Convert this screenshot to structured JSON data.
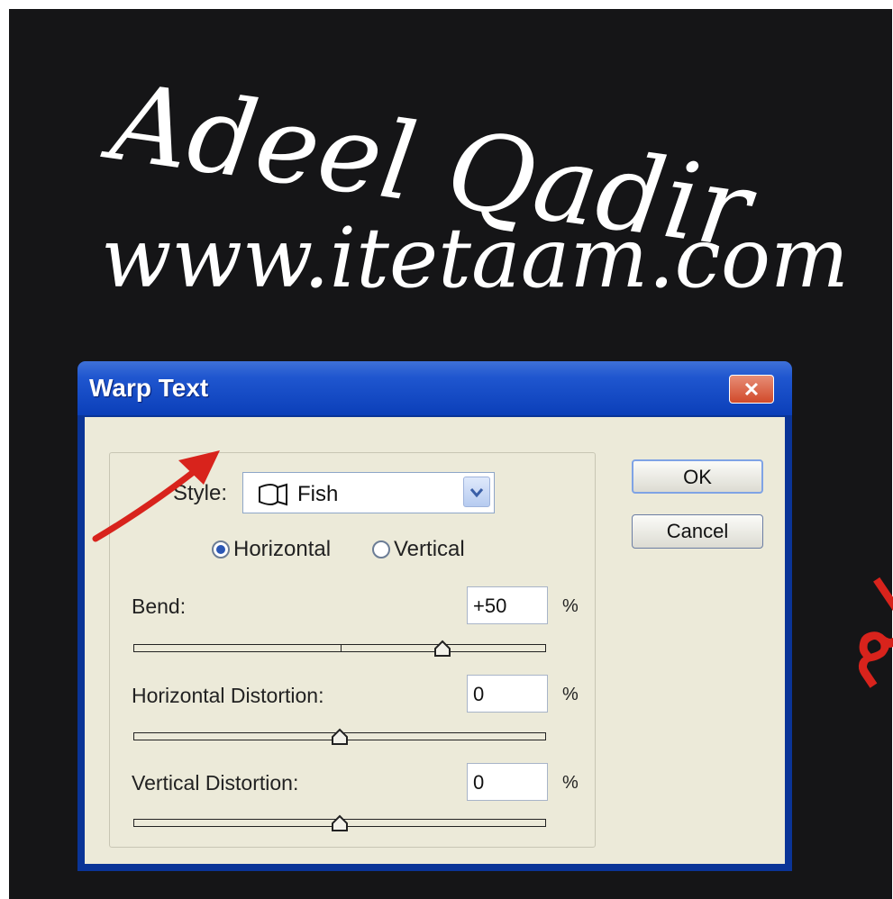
{
  "signature": {
    "line1": "Adeel Qadir",
    "line2": "www.itetaam.com"
  },
  "dialog": {
    "title": "Warp Text",
    "close_glyph": "✕",
    "style_label": "Style:",
    "style_value": "Fish",
    "orientation": {
      "horizontal_label": "Horizontal",
      "vertical_label": "Vertical",
      "selected": "Horizontal"
    },
    "bend": {
      "label": "Bend:",
      "value": "+50",
      "unit": "%",
      "percent": 50
    },
    "horizontal_distortion": {
      "label": "Horizontal Distortion:",
      "value": "0",
      "unit": "%",
      "percent": 0
    },
    "vertical_distortion": {
      "label": "Vertical Distortion:",
      "value": "0",
      "unit": "%",
      "percent": 0
    },
    "ok_label": "OK",
    "cancel_label": "Cancel"
  },
  "annotation": {
    "urdu_text": "آئی ٹی علم",
    "color": "#d8231c"
  },
  "colors": {
    "background": "#151517",
    "titlebar": "#0b3fb9",
    "dialog_face": "#ecead9"
  }
}
